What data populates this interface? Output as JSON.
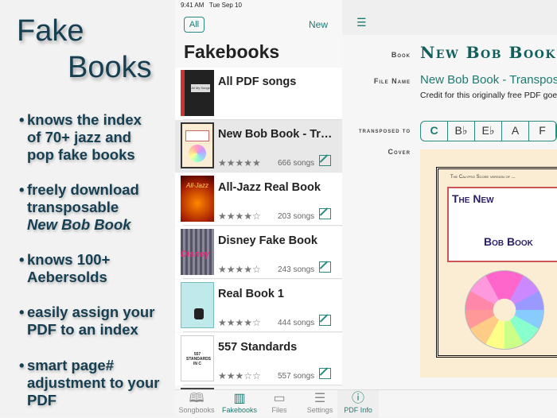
{
  "promo": {
    "title_line1": "Fake",
    "title_line2": "Books",
    "bullets": [
      {
        "text": "knows the index\nof 70+ jazz and\npop fake books"
      },
      {
        "text": "freely download\ntransposable",
        "italic": "New Bob Book"
      },
      {
        "text": "knows 100+\nAebersolds"
      },
      {
        "text": "easily assign your\nPDF to an index"
      },
      {
        "text": "smart page#\nadjustment to your\nPDF"
      }
    ]
  },
  "status": {
    "time": "9:41 AM",
    "date": "Tue Sep 10"
  },
  "list": {
    "all_label": "All",
    "new_label": "New",
    "title": "Fakebooks",
    "items": [
      {
        "name": "All PDF songs",
        "cover_text": "All My Songs"
      },
      {
        "name": "New Bob Book - Transposable",
        "stars": "★★★★★",
        "count": "666 songs",
        "selected": true
      },
      {
        "name": "All-Jazz Real Book",
        "stars": "★★★★☆",
        "count": "203 songs",
        "cover_text": "All-Jazz"
      },
      {
        "name": "Disney Fake Book",
        "stars": "★★★★☆",
        "count": "243 songs",
        "cover_text": "Disney"
      },
      {
        "name": "Real Book 1",
        "stars": "★★★★☆",
        "count": "444 songs"
      },
      {
        "name": "557 Standards",
        "stars": "★★★☆☆",
        "count": "557 songs",
        "cover_text": "557 STANDARDS IN C"
      }
    ]
  },
  "tabs": [
    {
      "label": "Songbooks",
      "icon": "book-open-icon"
    },
    {
      "label": "Fakebooks",
      "icon": "books-icon",
      "active": true
    },
    {
      "label": "Files",
      "icon": "folder-icon"
    },
    {
      "label": "Settings",
      "icon": "settings-list-icon"
    },
    {
      "label": "PDF Info",
      "icon": "info-icon",
      "active": true
    }
  ],
  "detail": {
    "book_label": "Book",
    "book_value": "New Bob Book",
    "file_label": "File Name",
    "file_value": "New Bob Book - Transposable",
    "credit": "Credit for this originally free PDF goes to",
    "transposed_label": "transposed to",
    "keys": [
      "C",
      "B♭",
      "E♭",
      "A",
      "F"
    ],
    "selected_key": "C",
    "cover_label": "Cover",
    "cover": {
      "header": "The Calypso Score version of ...",
      "title1": "The New",
      "title2": "Bob Book"
    }
  },
  "colors": {
    "accent": "#1d7a70",
    "promo_text": "#163f52"
  }
}
